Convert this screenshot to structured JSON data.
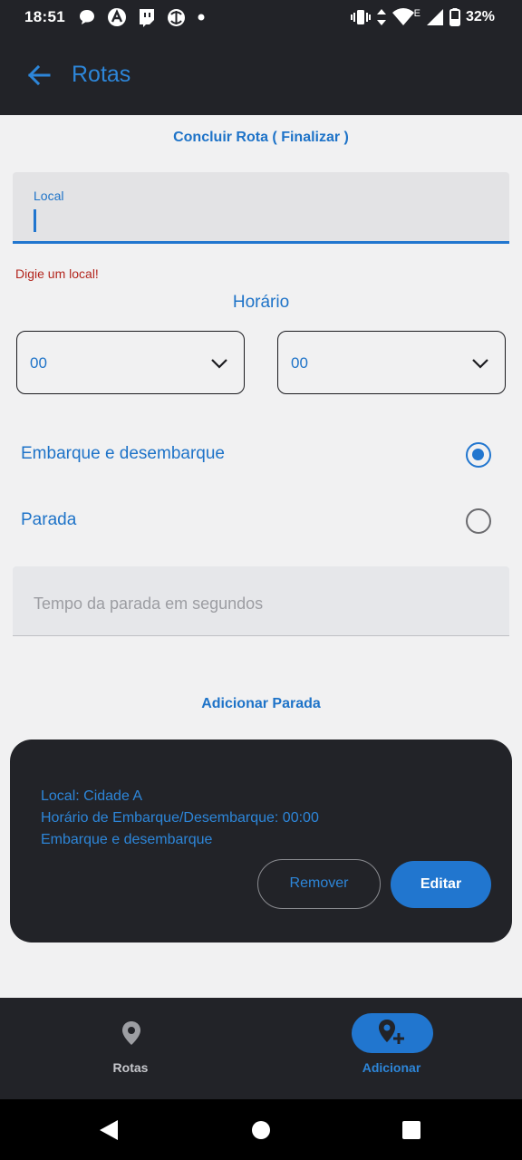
{
  "status_bar": {
    "time": "18:51",
    "left_icons": [
      "chat-bubble-icon",
      "app-a-icon",
      "twitch-icon",
      "sync-icon",
      "dot-icon"
    ],
    "right_icons": [
      "vibrate-icon",
      "data-arrows-icon",
      "wifi-icon",
      "signal-icon",
      "battery-icon"
    ],
    "network_letter": "E",
    "battery": "32%"
  },
  "app_bar": {
    "title": "Rotas",
    "back_icon": "arrow-left-icon"
  },
  "actions": {
    "conclude": "Concluir Rota ( Finalizar )",
    "add_stop": "Adicionar Parada"
  },
  "form": {
    "local_label": "Local",
    "local_value": "",
    "local_error": "Digie um local!",
    "horario_title": "Horário",
    "hour_value": "00",
    "minute_value": "00",
    "type_options": [
      {
        "label": "Embarque e desembarque",
        "selected": true
      },
      {
        "label": "Parada",
        "selected": false
      }
    ],
    "stop_time_placeholder": "Tempo da parada em segundos"
  },
  "stop_card": {
    "lines": [
      "Local: Cidade A",
      "Horário de Embarque/Desembarque: 00:00",
      "Embarque e desembarque"
    ],
    "remove_label": "Remover",
    "edit_label": "Editar"
  },
  "bottom_nav": {
    "items": [
      {
        "label": "Rotas",
        "icon": "map-pin-icon",
        "active": false
      },
      {
        "label": "Adicionar",
        "icon": "add-location-icon",
        "active": true
      }
    ]
  },
  "colors": {
    "accent": "#2176cf",
    "text_blue": "#1e73c8",
    "dark_surface": "#222328",
    "background": "#f1f1f2",
    "error": "#b3261e"
  }
}
